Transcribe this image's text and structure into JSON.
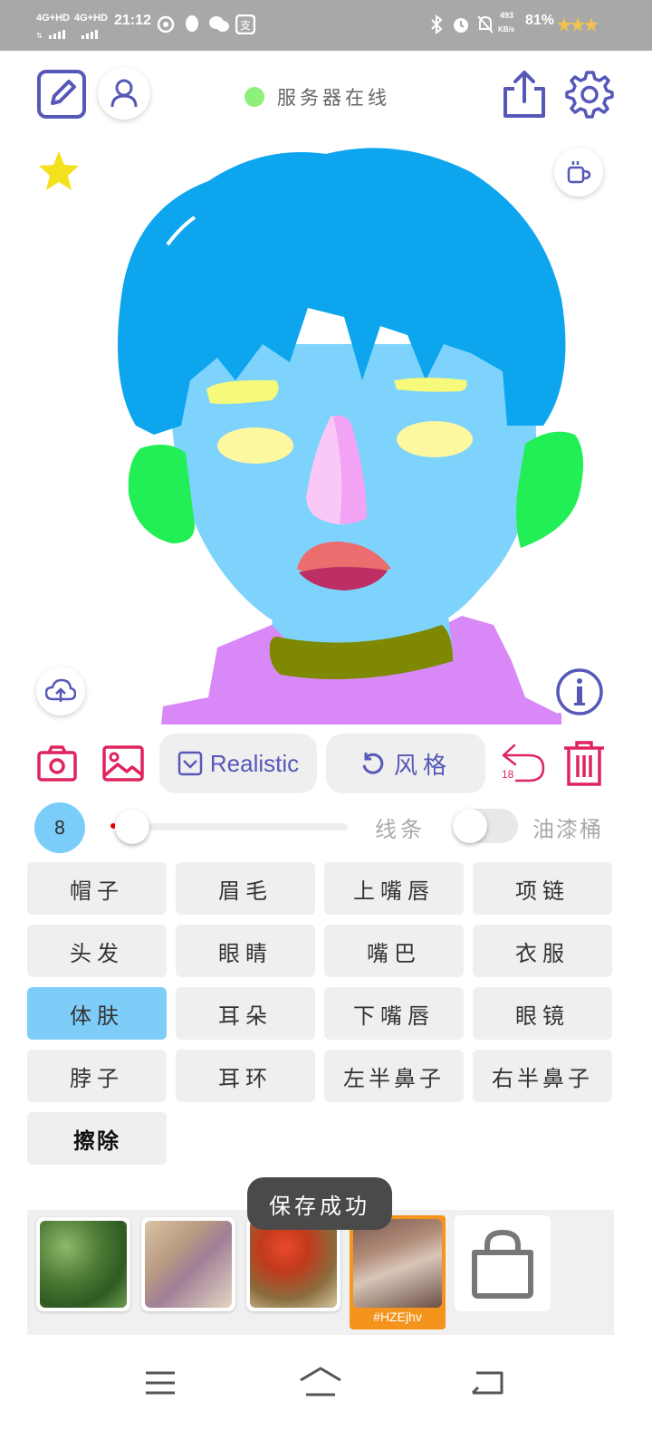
{
  "status_bar": {
    "network_1": "4G+HD",
    "network_2": "4G+HD",
    "time": "21:12",
    "speed": "493",
    "speed_unit": "KB/s",
    "battery": "81%"
  },
  "header": {
    "server_status": "服务器在线",
    "server_status_color": "#8ef07a"
  },
  "toolbar": {
    "style_button": "Realistic",
    "style_reset": "风格",
    "undo_count": "18"
  },
  "brush": {
    "size": "8",
    "line_label": "线条",
    "bucket_label": "油漆桶",
    "slider_value": 0.0
  },
  "parts": [
    {
      "label": "帽子"
    },
    {
      "label": "眉毛"
    },
    {
      "label": "上嘴唇"
    },
    {
      "label": "项链"
    },
    {
      "label": "头发"
    },
    {
      "label": "眼睛"
    },
    {
      "label": "嘴巴"
    },
    {
      "label": "衣服"
    },
    {
      "label": "体肤"
    },
    {
      "label": "耳朵"
    },
    {
      "label": "下嘴唇"
    },
    {
      "label": "眼镜"
    },
    {
      "label": "脖子"
    },
    {
      "label": "耳环"
    },
    {
      "label": "左半鼻子"
    },
    {
      "label": "右半鼻子"
    },
    {
      "label": "擦除"
    }
  ],
  "active_part": "体肤",
  "toast": "保存成功",
  "gallery": {
    "selected_tag": "#HZEjhv"
  },
  "colors": {
    "accent": "#5658b8",
    "danger": "#e0245e",
    "selected": "#7ecdf8",
    "hair": "#0ea5ef",
    "skin": "#7dd3fb",
    "ears": "#22ee55",
    "clothes": "#d889f7",
    "necklace": "#7e8800"
  }
}
